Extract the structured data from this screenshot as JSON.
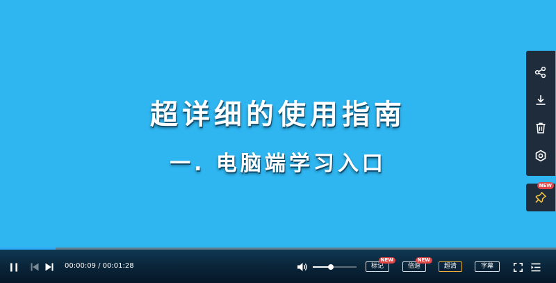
{
  "slide": {
    "title": "超详细的使用指南",
    "subtitle": "一. 电脑端学习入口"
  },
  "side_toolbar": {
    "icons": [
      "share-icon",
      "download-icon",
      "delete-icon",
      "settings-icon"
    ],
    "pin_badge": "NEW"
  },
  "player": {
    "time": {
      "current": "00:00:09",
      "separator": " / ",
      "total": "00:01:28"
    },
    "progress_fraction": 0.1,
    "volume_fraction": 0.42,
    "buttons": {
      "mark": {
        "label": "标记",
        "badge": "NEW"
      },
      "speed": {
        "label": "倍速",
        "badge": "NEW"
      },
      "quality": {
        "label": "超清"
      },
      "subtitles": {
        "label": "字幕"
      }
    },
    "colors": {
      "progress": "#2fa8ff",
      "badge": "#e24545",
      "quality_active": "#e8b23a"
    }
  }
}
